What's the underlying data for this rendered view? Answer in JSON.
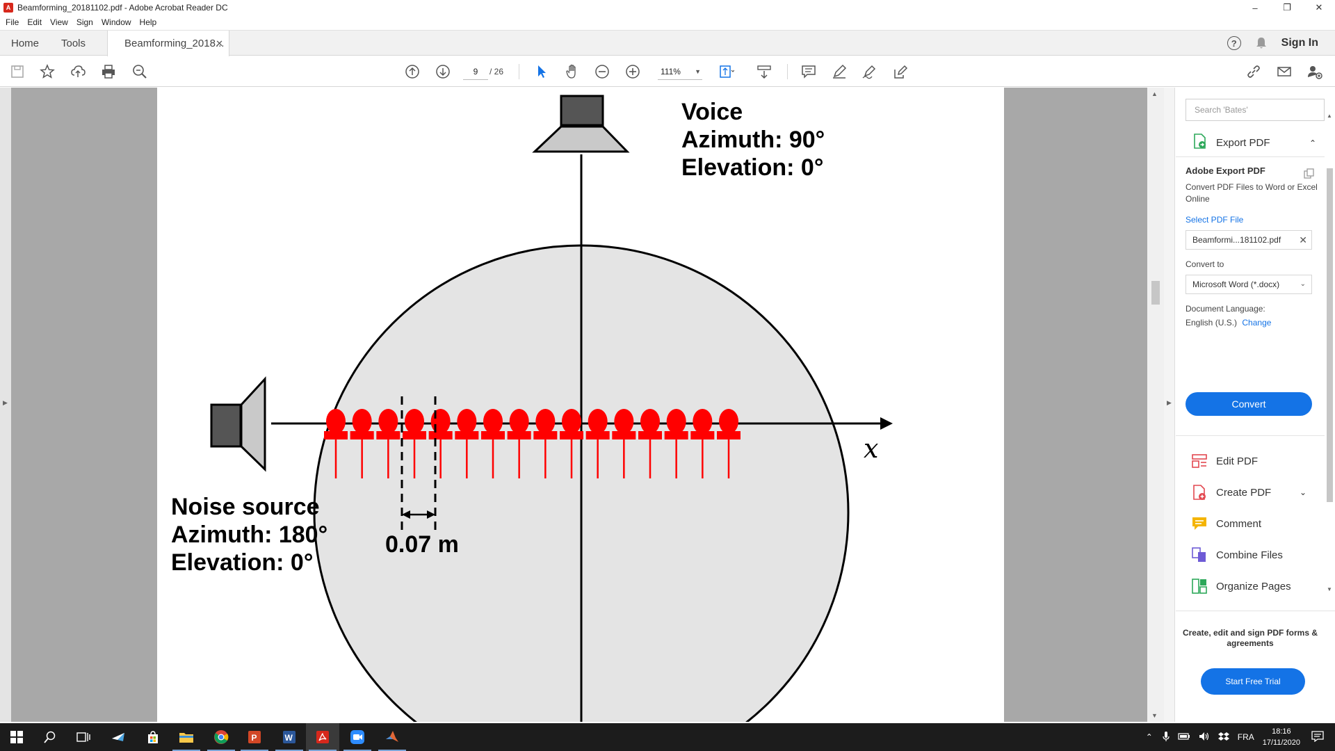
{
  "window": {
    "title": "Beamforming_20181102.pdf - Adobe Acrobat Reader DC"
  },
  "menu": [
    "File",
    "Edit",
    "View",
    "Sign",
    "Window",
    "Help"
  ],
  "tabs": {
    "home": "Home",
    "tools": "Tools",
    "document": "Beamforming_2018...",
    "sign_in": "Sign In"
  },
  "toolbar": {
    "current_page": "9",
    "page_total": "/ 26",
    "zoom": "111%"
  },
  "figure": {
    "voice_label": "Voice",
    "voice_azimuth": "Azimuth: 90°",
    "voice_elevation": "Elevation: 0°",
    "noise_label": "Noise source",
    "noise_azimuth": "Azimuth: 180°",
    "noise_elevation": "Elevation: 0°",
    "spacing": "0.07 m",
    "axis_label": "x",
    "microphone_count": 16,
    "mic_color": "#ff0000"
  },
  "panel": {
    "search_placeholder": "Search 'Bates'",
    "export_title": "Export PDF",
    "adobe_export_heading": "Adobe Export PDF",
    "adobe_export_desc": "Convert PDF Files to Word or Excel Online",
    "select_file_link": "Select PDF File",
    "selected_file": "Beamformi...181102.pdf",
    "convert_to_label": "Convert to",
    "convert_to_value": "Microsoft Word (*.docx)",
    "doc_lang_label": "Document Language:",
    "doc_lang_value": "English (U.S.)",
    "change_link": "Change",
    "convert_button": "Convert",
    "tools": [
      {
        "label": "Edit PDF",
        "color": "#e34850"
      },
      {
        "label": "Create PDF",
        "color": "#e34850"
      },
      {
        "label": "Comment",
        "color": "#f4b400"
      },
      {
        "label": "Combine Files",
        "color": "#6e5bd6"
      },
      {
        "label": "Organize Pages",
        "color": "#2da85a"
      }
    ],
    "promo_text": "Create, edit and sign PDF forms & agreements",
    "trial_button": "Start Free Trial"
  },
  "taskbar": {
    "language": "FRA",
    "time": "18:16",
    "date": "17/11/2020"
  },
  "colors": {
    "accent": "#1473e6",
    "mic_red": "#ff0000"
  }
}
